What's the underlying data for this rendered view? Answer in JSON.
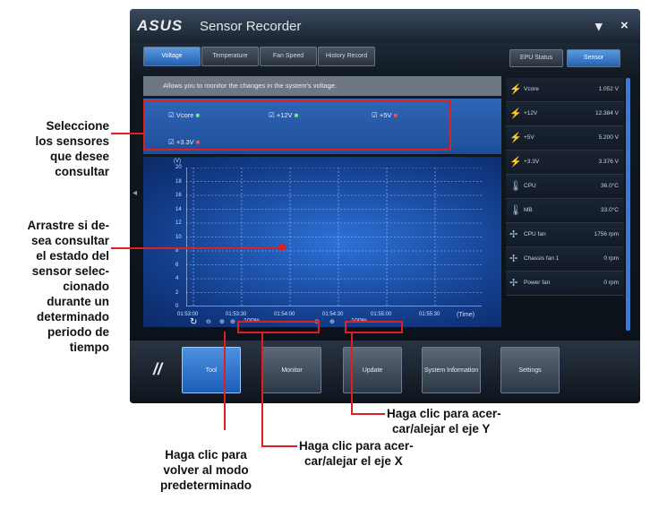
{
  "window": {
    "app_title": "Sensor Recorder",
    "logo": "ASUS",
    "minimize_label": "▾",
    "close_label": "×",
    "tabs": [
      {
        "label": "Voltage",
        "active": true
      },
      {
        "label": "Temperature",
        "active": false
      },
      {
        "label": "Fan Speed",
        "active": false
      },
      {
        "label": "History Record",
        "active": false
      }
    ],
    "description": "Allows you to monitor the changes in the system's voltage.",
    "sensors": [
      {
        "label": "Vcore",
        "checked": true
      },
      {
        "label": "+12V",
        "checked": true
      },
      {
        "label": "+5V",
        "checked": true
      },
      {
        "label": "+3.3V",
        "checked": true
      }
    ],
    "chart": {
      "y_unit": "(V)",
      "y_ticks": [
        "20",
        "18",
        "16",
        "14",
        "12",
        "10",
        "8",
        "6",
        "4",
        "2",
        "0"
      ],
      "x_ticks": [
        "01:53:00",
        "01:53:30",
        "01:54:00",
        "01:54:30",
        "01:55:00",
        "01:55:30"
      ],
      "x_unit": "(Time)",
      "zoom_x": "100%",
      "zoom_y": "100%"
    },
    "right_panel": {
      "tabs": [
        {
          "label": "EPU Status",
          "active": false
        },
        {
          "label": "Sensor",
          "active": true
        }
      ],
      "rows": [
        {
          "icon": "bolt-icon",
          "name": "Vcore",
          "value": "1.052 V"
        },
        {
          "icon": "bolt-icon",
          "name": "+12V",
          "value": "12.384 V"
        },
        {
          "icon": "bolt-icon",
          "name": "+5V",
          "value": "5.200 V"
        },
        {
          "icon": "bolt-icon",
          "name": "+3.3V",
          "value": "3.376 V"
        },
        {
          "icon": "thermometer-icon",
          "name": "CPU",
          "value": "36.0°C"
        },
        {
          "icon": "thermometer-icon",
          "name": "MB",
          "value": "33.0°C"
        },
        {
          "icon": "fan-icon",
          "name": "CPU fan",
          "value": "1756 rpm"
        },
        {
          "icon": "fan-icon",
          "name": "Chassis fan 1",
          "value": "0 rpm"
        },
        {
          "icon": "fan-icon",
          "name": "Power fan",
          "value": "0 rpm"
        }
      ]
    },
    "bottom_buttons": [
      {
        "label": "Tool",
        "active": true
      },
      {
        "label": "Monitor",
        "active": false
      },
      {
        "label": "Update",
        "active": false
      },
      {
        "label": "System Information",
        "active": false
      },
      {
        "label": "Settings",
        "active": false
      }
    ]
  },
  "callouts": {
    "select_sensors": [
      "Seleccione",
      "los sensores",
      "que desee",
      "consultar"
    ],
    "drag": [
      "Arrastre si de-",
      "sea consultar",
      "el estado del",
      "sensor selec-",
      "cionado",
      "durante un",
      "determinado",
      "periodo de",
      "tiempo"
    ],
    "zoom_y": [
      "Haga clic para acer-",
      "car/alejar el eje Y"
    ],
    "zoom_x": [
      "Haga clic para acer-",
      "car/alejar el eje X"
    ],
    "reset": [
      "Haga clic para",
      "volver al modo",
      "predeterminado"
    ]
  },
  "colors": {
    "window_bg": "#0f1720",
    "accent_blue": "#2c72d8",
    "callout_line": "#e02020"
  }
}
